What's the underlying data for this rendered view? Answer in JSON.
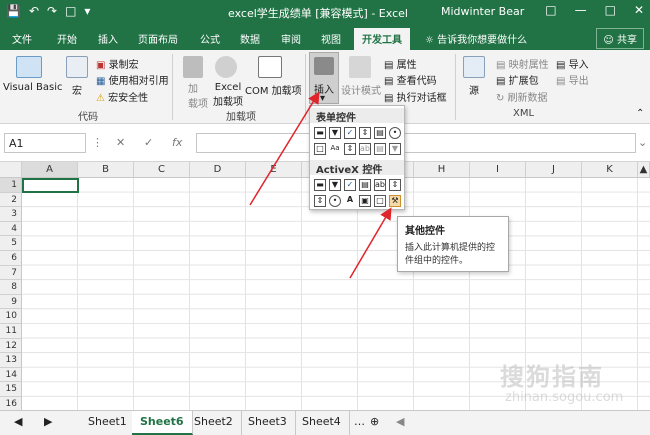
{
  "titlebar": {
    "title": "excel学生成绩单  [兼容模式]  -  Excel",
    "user": "Midwinter Bear"
  },
  "menu": {
    "tabs": [
      "文件",
      "开始",
      "插入",
      "页面布局",
      "公式",
      "数据",
      "审阅",
      "视图",
      "开发工具"
    ],
    "active": "开发工具",
    "tell": "告诉我你想要做什么",
    "share": "共享"
  },
  "ribbon": {
    "vb": "Visual Basic",
    "macro": "宏",
    "record": "录制宏",
    "relative": "使用相对引用",
    "security": "宏安全性",
    "group_code": "代码",
    "addins": "加\n载项",
    "addins_line1": "加",
    "addins_line2": "载项",
    "excel_addins_1": "Excel",
    "excel_addins_2": "加载项",
    "com_addins": "COM 加载项",
    "group_addins": "加载项",
    "insert": "插入",
    "design": "设计模式",
    "props": "属性",
    "viewcode": "查看代码",
    "dialog": "执行对话框",
    "source": "源",
    "map_props": "映射属性",
    "expand": "扩展包",
    "refresh": "刷新数据",
    "import": "导入",
    "export": "导出",
    "group_xml": "XML"
  },
  "formula": {
    "namebox": "A1",
    "fx": "fx"
  },
  "grid": {
    "columns": [
      "A",
      "B",
      "C",
      "D",
      "E",
      "F",
      "G",
      "H",
      "I",
      "J",
      "K"
    ],
    "rows": [
      "1",
      "2",
      "3",
      "4",
      "5",
      "6",
      "7",
      "8",
      "9",
      "10",
      "11",
      "12",
      "13",
      "14",
      "15",
      "16"
    ]
  },
  "dropdown": {
    "form_header": "表单控件",
    "activex_header": "ActiveX 控件"
  },
  "tooltip": {
    "title": "其他控件",
    "desc": "插入此计算机提供的控件组中的控件。"
  },
  "sheets": [
    "Sheet1",
    "Sheet6",
    "Sheet2",
    "Sheet3",
    "Sheet4"
  ],
  "active_sheet": "Sheet6",
  "watermark": "搜狗指南",
  "watermark_url": "zhinan.sogou.com",
  "colors": {
    "excel_green": "#217346",
    "arrow_red": "#e0242b"
  }
}
